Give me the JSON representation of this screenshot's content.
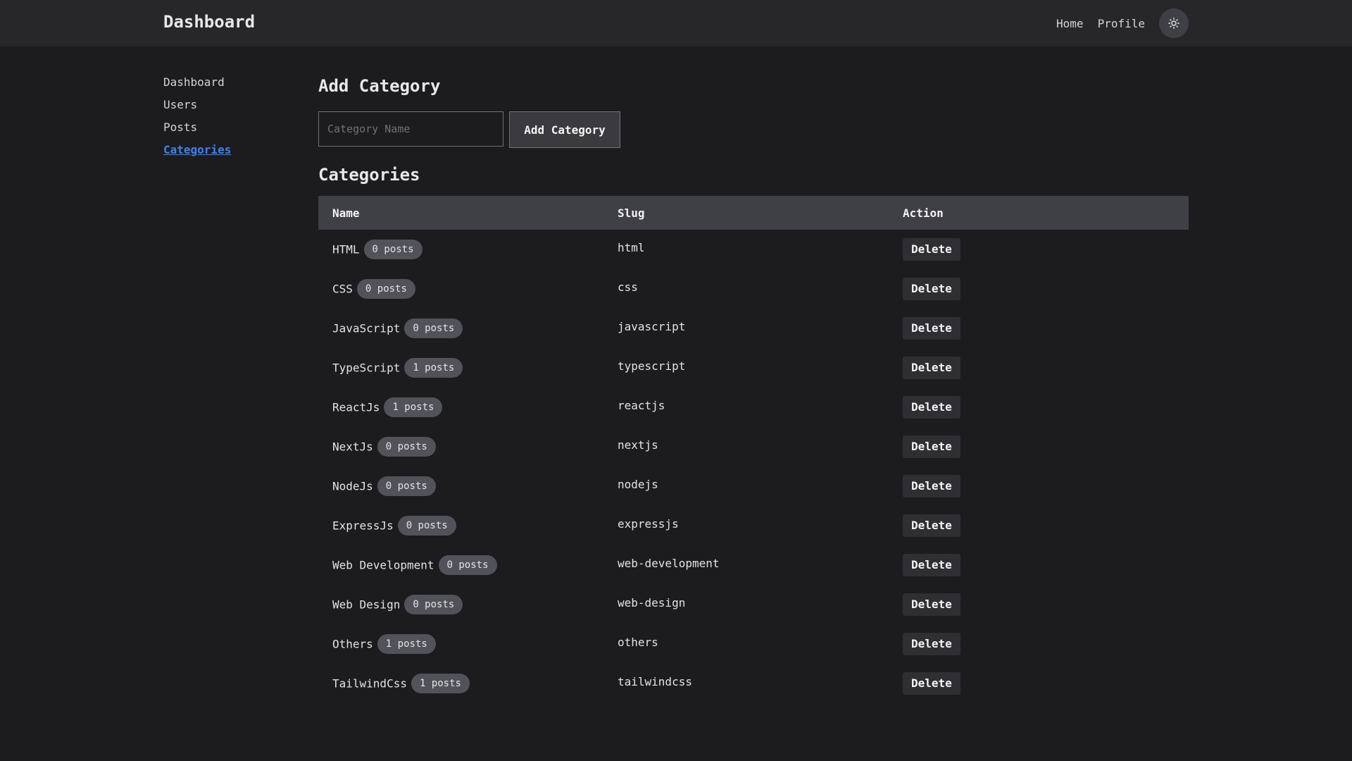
{
  "header": {
    "brand": "Dashboard",
    "nav": [
      {
        "label": "Home"
      },
      {
        "label": "Profile"
      }
    ],
    "theme_toggle_icon": "sun-icon"
  },
  "sidebar": {
    "items": [
      {
        "label": "Dashboard",
        "active": false
      },
      {
        "label": "Users",
        "active": false
      },
      {
        "label": "Posts",
        "active": false
      },
      {
        "label": "Categories",
        "active": true
      }
    ]
  },
  "add_form": {
    "title": "Add Category",
    "input_placeholder": "Category Name",
    "input_value": "",
    "button_label": "Add Category"
  },
  "categories": {
    "title": "Categories",
    "columns": [
      "Name",
      "Slug",
      "Action"
    ],
    "rows": [
      {
        "name": "HTML",
        "posts": "0 posts",
        "slug": "html",
        "action": "Delete"
      },
      {
        "name": "CSS",
        "posts": "0 posts",
        "slug": "css",
        "action": "Delete"
      },
      {
        "name": "JavaScript",
        "posts": "0 posts",
        "slug": "javascript",
        "action": "Delete"
      },
      {
        "name": "TypeScript",
        "posts": "1 posts",
        "slug": "typescript",
        "action": "Delete"
      },
      {
        "name": "ReactJs",
        "posts": "1 posts",
        "slug": "reactjs",
        "action": "Delete"
      },
      {
        "name": "NextJs",
        "posts": "0 posts",
        "slug": "nextjs",
        "action": "Delete"
      },
      {
        "name": "NodeJs",
        "posts": "0 posts",
        "slug": "nodejs",
        "action": "Delete"
      },
      {
        "name": "ExpressJs",
        "posts": "0 posts",
        "slug": "expressjs",
        "action": "Delete"
      },
      {
        "name": "Web Development",
        "posts": "0 posts",
        "slug": "web-development",
        "action": "Delete"
      },
      {
        "name": "Web Design",
        "posts": "0 posts",
        "slug": "web-design",
        "action": "Delete"
      },
      {
        "name": "Others",
        "posts": "1 posts",
        "slug": "others",
        "action": "Delete"
      },
      {
        "name": "TailwindCss",
        "posts": "1 posts",
        "slug": "tailwindcss",
        "action": "Delete"
      }
    ]
  },
  "colors": {
    "background": "#1c1c1e",
    "topbar": "#27272a",
    "accent": "#3b82f6",
    "table_header": "#3f3f46",
    "badge": "#52525b"
  }
}
